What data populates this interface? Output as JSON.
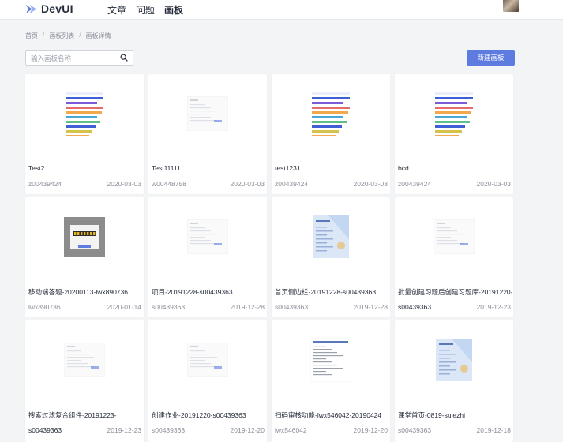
{
  "app": {
    "name": "DevUI"
  },
  "nav": {
    "items": [
      "文章",
      "问题",
      "画板"
    ]
  },
  "breadcrumb": {
    "items": [
      "首页",
      "画板列表",
      "画板详情"
    ],
    "separator": "/"
  },
  "search": {
    "placeholder": "输入画板名称",
    "value": ""
  },
  "actions": {
    "new_board": "新建画板"
  },
  "colors": {
    "accent": "#5e7ce0",
    "background": "#f3f4f6"
  },
  "cards": [
    {
      "title": "Test2",
      "owner": "z00439424",
      "date": "2020-03-03",
      "thumb": "color-bars"
    },
    {
      "title": "Test11111",
      "owner": "w00448758",
      "date": "2020-03-03",
      "thumb": "page-sketch"
    },
    {
      "title": "test1231",
      "owner": "z00439424",
      "date": "2020-03-03",
      "thumb": "color-bars"
    },
    {
      "title": "bcd",
      "owner": "z00439424",
      "date": "2020-03-03",
      "thumb": "color-bars"
    },
    {
      "title": "移动端答题-20200113-lwx890736",
      "owner": "lwx890736",
      "date": "2020-01-14",
      "thumb": "mobile-quiz"
    },
    {
      "title": "项目-20191228-s00439363",
      "owner": "",
      "date": "",
      "thumb": "page-sketch"
    },
    {
      "title": "首页侧边栏-20191228-s00439363",
      "owner": "s00439363",
      "date": "2019-12-28",
      "thumb": "blue-page"
    },
    {
      "title": "批量创建习题后创建习题库-20191220-",
      "owner": "s00439363",
      "date": "2019-12-23",
      "thumb": "page-sketch"
    },
    {
      "title": "搜索过滤复合组件-20191223-",
      "owner": "s00439363",
      "date": "2019-12-23",
      "thumb": "page-sketch"
    },
    {
      "title": "创建作业-20191220-s00439363",
      "owner": "s00439363",
      "date": "2019-12-20",
      "thumb": "page-sketch"
    },
    {
      "title": "扫码审核功能-lwx546042-20190424",
      "owner": "lwx546042",
      "date": "2019-12-20",
      "thumb": "doc-page"
    },
    {
      "title": "课堂首页-0819-sulezhi",
      "owner": "s00439363",
      "date": "2019-12-18",
      "thumb": "blue-page"
    }
  ],
  "card6_meta": {
    "owner": "s00439363",
    "date": "2019-12-28"
  }
}
